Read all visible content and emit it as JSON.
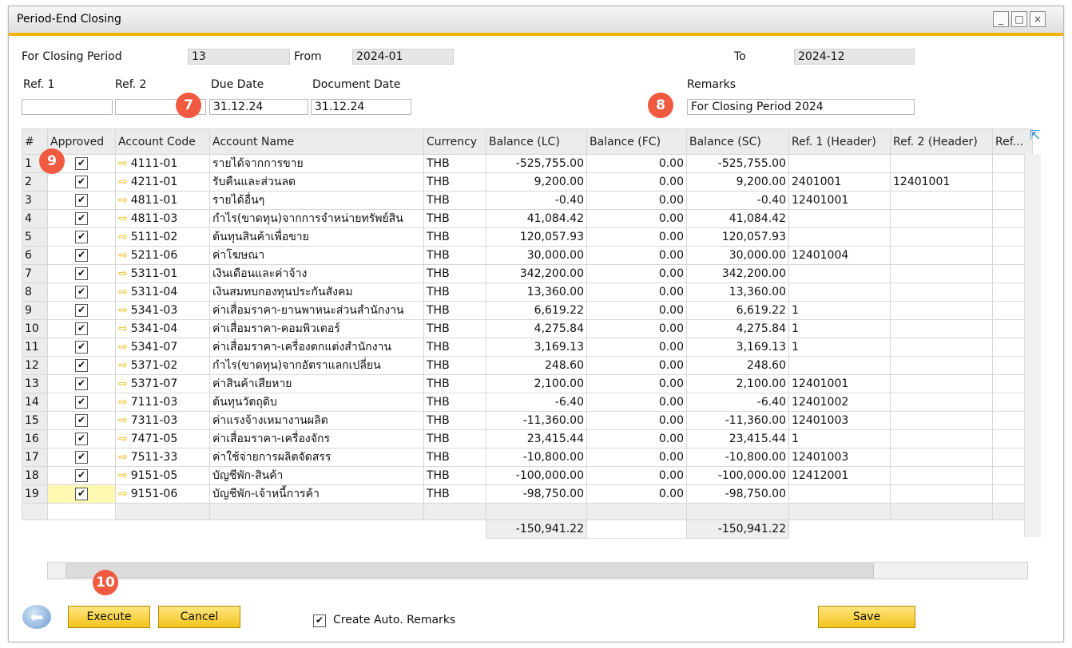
{
  "window": {
    "title": "Period-End Closing",
    "minimize": "_",
    "maximize": "□",
    "close": "×"
  },
  "header": {
    "closing_period_label": "For Closing Period",
    "closing_period_value": "13",
    "from_label": "From",
    "from_value": "2024-01",
    "to_label": "To",
    "to_value": "2024-12",
    "ref1_label": "Ref. 1",
    "ref1_value": "",
    "ref2_label": "Ref. 2",
    "ref2_value": "",
    "due_date_label": "Due Date",
    "due_date_value": "31.12.24",
    "doc_date_label": "Document Date",
    "doc_date_value": "31.12.24",
    "remarks_label": "Remarks",
    "remarks_value": "For Closing Period 2024"
  },
  "badges": {
    "b7": "7",
    "b8": "8",
    "b9": "9",
    "b10": "10"
  },
  "grid": {
    "columns": [
      "#",
      "Approved",
      "Account Code",
      "Account Name",
      "Currency",
      "Balance (LC)",
      "Balance (FC)",
      "Balance (SC)",
      "Ref. 1 (Header)",
      "Ref. 2 (Header)",
      "Ref..."
    ],
    "rows": [
      {
        "n": "1",
        "code": "4111-01",
        "name": "รายได้จากการขาย",
        "cur": "THB",
        "lc": "-525,755.00",
        "fc": "0.00",
        "sc": "-525,755.00",
        "r1": "",
        "r2": ""
      },
      {
        "n": "2",
        "code": "4211-01",
        "name": "รับคืนและส่วนลด",
        "cur": "THB",
        "lc": "9,200.00",
        "fc": "0.00",
        "sc": "9,200.00",
        "r1": "2401001",
        "r2": "12401001"
      },
      {
        "n": "3",
        "code": "4811-01",
        "name": "รายได้อื่นๆ",
        "cur": "THB",
        "lc": "-0.40",
        "fc": "0.00",
        "sc": "-0.40",
        "r1": "12401001",
        "r2": ""
      },
      {
        "n": "4",
        "code": "4811-03",
        "name": "กำไร(ขาดทุน)จากการจำหน่ายทรัพย์สิน",
        "cur": "THB",
        "lc": "41,084.42",
        "fc": "0.00",
        "sc": "41,084.42",
        "r1": "",
        "r2": ""
      },
      {
        "n": "5",
        "code": "5111-02",
        "name": "ต้นทุนสินค้าเพื่อขาย",
        "cur": "THB",
        "lc": "120,057.93",
        "fc": "0.00",
        "sc": "120,057.93",
        "r1": "",
        "r2": ""
      },
      {
        "n": "6",
        "code": "5211-06",
        "name": "ค่าโฆษณา",
        "cur": "THB",
        "lc": "30,000.00",
        "fc": "0.00",
        "sc": "30,000.00",
        "r1": "12401004",
        "r2": ""
      },
      {
        "n": "7",
        "code": "5311-01",
        "name": "เงินเดือนและค่าจ้าง",
        "cur": "THB",
        "lc": "342,200.00",
        "fc": "0.00",
        "sc": "342,200.00",
        "r1": "",
        "r2": ""
      },
      {
        "n": "8",
        "code": "5311-04",
        "name": "เงินสมทบกองทุนประกันสังคม",
        "cur": "THB",
        "lc": "13,360.00",
        "fc": "0.00",
        "sc": "13,360.00",
        "r1": "",
        "r2": ""
      },
      {
        "n": "9",
        "code": "5341-03",
        "name": "ค่าเสื่อมราคา-ยานพาหนะส่วนสำนักงาน",
        "cur": "THB",
        "lc": "6,619.22",
        "fc": "0.00",
        "sc": "6,619.22",
        "r1": "1",
        "r2": ""
      },
      {
        "n": "10",
        "code": "5341-04",
        "name": "ค่าเสื่อมราคา-คอมพิวเตอร์",
        "cur": "THB",
        "lc": "4,275.84",
        "fc": "0.00",
        "sc": "4,275.84",
        "r1": "1",
        "r2": ""
      },
      {
        "n": "11",
        "code": "5341-07",
        "name": "ค่าเสื่อมราคา-เครื่องตกแต่งสำนักงาน",
        "cur": "THB",
        "lc": "3,169.13",
        "fc": "0.00",
        "sc": "3,169.13",
        "r1": "1",
        "r2": ""
      },
      {
        "n": "12",
        "code": "5371-02",
        "name": "กำไร(ขาดทุน)จากอัตราแลกเปลี่ยน",
        "cur": "THB",
        "lc": "248.60",
        "fc": "0.00",
        "sc": "248.60",
        "r1": "",
        "r2": ""
      },
      {
        "n": "13",
        "code": "5371-07",
        "name": "ค่าสินค้าเสียหาย",
        "cur": "THB",
        "lc": "2,100.00",
        "fc": "0.00",
        "sc": "2,100.00",
        "r1": "12401001",
        "r2": ""
      },
      {
        "n": "14",
        "code": "7111-03",
        "name": "ต้นทุนวัตถุดิบ",
        "cur": "THB",
        "lc": "-6.40",
        "fc": "0.00",
        "sc": "-6.40",
        "r1": "12401002",
        "r2": ""
      },
      {
        "n": "15",
        "code": "7311-03",
        "name": "ค่าแรงจ้างเหมางานผลิต",
        "cur": "THB",
        "lc": "-11,360.00",
        "fc": "0.00",
        "sc": "-11,360.00",
        "r1": "12401003",
        "r2": ""
      },
      {
        "n": "16",
        "code": "7471-05",
        "name": "ค่าเสื่อมราคา-เครื่องจักร",
        "cur": "THB",
        "lc": "23,415.44",
        "fc": "0.00",
        "sc": "23,415.44",
        "r1": "1",
        "r2": ""
      },
      {
        "n": "17",
        "code": "7511-33",
        "name": "ค่าใช้จ่ายการผลิตจัดสรร",
        "cur": "THB",
        "lc": "-10,800.00",
        "fc": "0.00",
        "sc": "-10,800.00",
        "r1": "12401003",
        "r2": ""
      },
      {
        "n": "18",
        "code": "9151-05",
        "name": "บัญชีพัก-สินค้า",
        "cur": "THB",
        "lc": "-100,000.00",
        "fc": "0.00",
        "sc": "-100,000.00",
        "r1": "12412001",
        "r2": ""
      },
      {
        "n": "19",
        "code": "9151-06",
        "name": "บัญชีพัก-เจ้าหนี้การค้า",
        "cur": "THB",
        "lc": "-98,750.00",
        "fc": "0.00",
        "sc": "-98,750.00",
        "r1": "",
        "r2": ""
      }
    ],
    "total_lc": "-150,941.22",
    "total_sc": "-150,941.22",
    "approved_check": "✔",
    "link_arrow": "⇨",
    "expand_icon": "⇱"
  },
  "footer": {
    "execute_label": "Execute",
    "cancel_label": "Cancel",
    "auto_remarks_label": "Create Auto. Remarks",
    "save_label": "Save",
    "back_icon": "⬅"
  }
}
